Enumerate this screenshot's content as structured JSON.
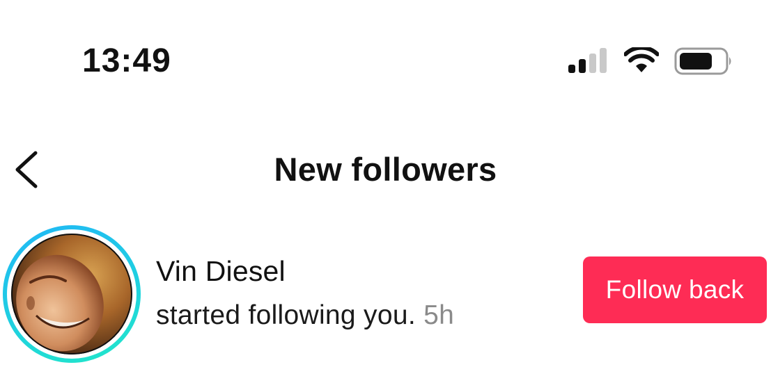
{
  "status_bar": {
    "time": "13:49",
    "signal_icon": "cellular-signal-icon",
    "wifi_icon": "wifi-icon",
    "battery_icon": "battery-icon"
  },
  "nav": {
    "back_icon": "chevron-left-icon",
    "title": "New followers"
  },
  "notifications": [
    {
      "username": "Vin Diesel",
      "message": "started following you.",
      "time_ago": "5h",
      "action_label": "Follow back"
    }
  ],
  "colors": {
    "accent": "#fe2c55",
    "avatar_ring_start": "#21b7f6",
    "avatar_ring_end": "#22e8c8",
    "timestamp": "#8a8a8a"
  }
}
